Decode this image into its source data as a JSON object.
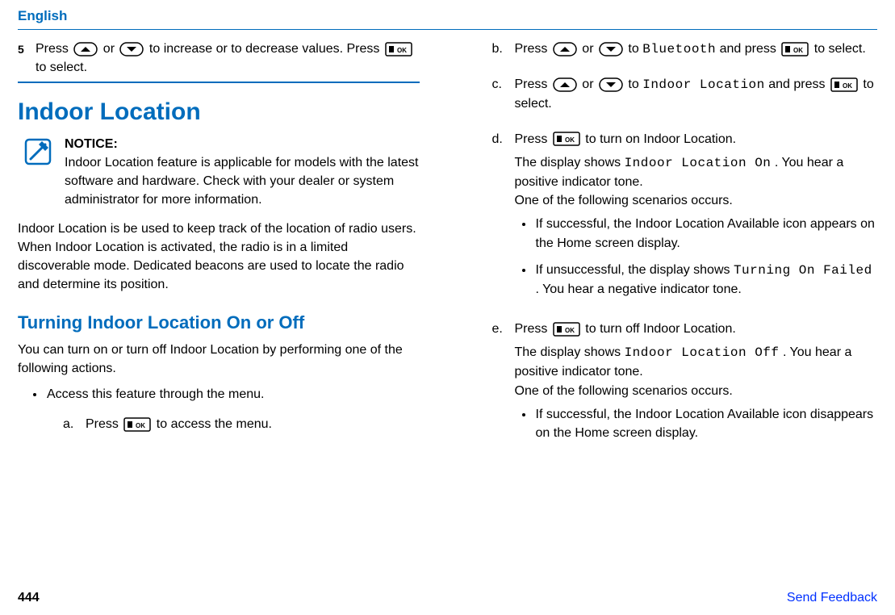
{
  "header_lang": "English",
  "left": {
    "step5": {
      "num": "5",
      "part1": "Press ",
      "or": " or ",
      "part2": " to increase or to decrease values. Press ",
      "part3": " to select."
    },
    "h1": "Indoor Location",
    "notice": {
      "label": "NOTICE:",
      "text": "Indoor Location feature is applicable for models with the latest software and hardware. Check with your dealer or system administrator for more information."
    },
    "para1": "Indoor Location is be used to keep track of the location of radio users. When Indoor Location is activated, the radio is in a limited discoverable mode. Dedicated beacons are used to locate the radio and determine its position.",
    "h2": "Turning Indoor Location On or Off",
    "para2": "You can turn on or turn off Indoor Location by performing one of the following actions.",
    "bullet1": "Access this feature through the menu.",
    "sub_a": {
      "letter": "a.",
      "t1": "Press ",
      "t2": " to access the menu."
    }
  },
  "right": {
    "sub_b": {
      "letter": "b.",
      "t1": "Press ",
      "or": " or ",
      "t2": " to ",
      "lcd": "Bluetooth",
      "t3": " and press ",
      "t4": " to select."
    },
    "sub_c": {
      "letter": "c.",
      "t1": "Press ",
      "or": " or ",
      "t2": " to ",
      "lcd": "Indoor Location",
      "t3": " and press ",
      "t4": " to select."
    },
    "sub_d": {
      "letter": "d.",
      "t1": "Press ",
      "t2": " to turn on Indoor Location.",
      "res1a": "The display shows ",
      "res1_lcd": "Indoor Location On",
      "res1b": ". You hear a positive indicator tone.",
      "res2": "One of the following scenarios occurs.",
      "b1": "If successful, the Indoor Location Available icon appears on the Home screen display.",
      "b2a": "If unsuccessful, the display shows ",
      "b2_lcd": "Turning On Failed",
      "b2b": ". You hear a negative indicator tone."
    },
    "sub_e": {
      "letter": "e.",
      "t1": "Press ",
      "t2": " to turn off Indoor Location.",
      "res1a": "The display shows ",
      "res1_lcd": "Indoor Location Off",
      "res1b": ". You hear a positive indicator tone.",
      "res2": "One of the following scenarios occurs.",
      "b1": "If successful, the Indoor Location Available icon disappears on the Home screen display."
    }
  },
  "footer": {
    "page": "444",
    "feedback": "Send Feedback"
  }
}
